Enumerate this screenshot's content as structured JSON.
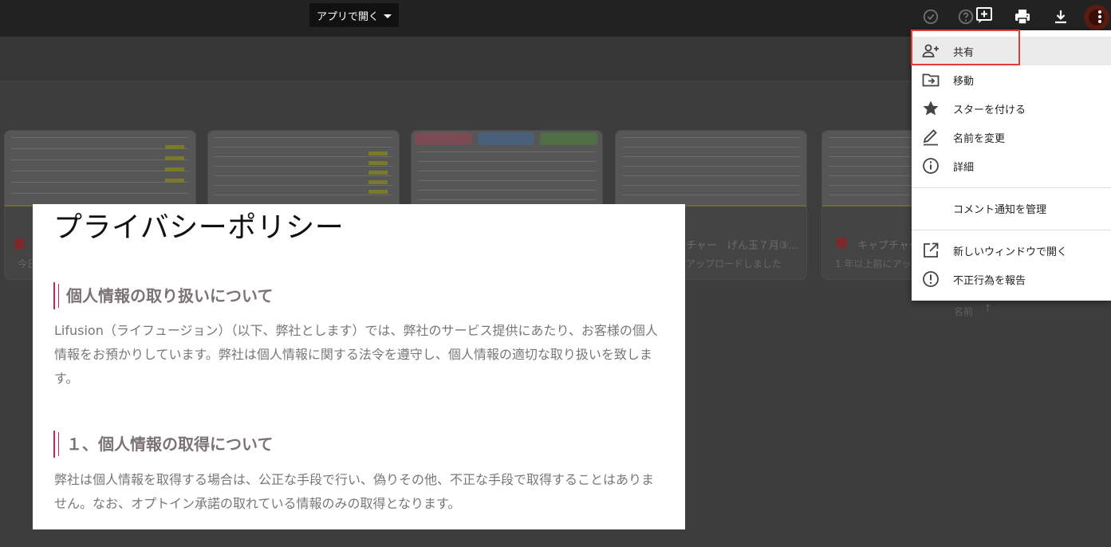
{
  "toolbar": {
    "open_with_label": "アプリで開く"
  },
  "background": {
    "cards": [
      {
        "name": "",
        "subtitle": "今日"
      },
      {
        "name": "",
        "subtitle": ""
      },
      {
        "name": "",
        "subtitle": ""
      },
      {
        "name": "チャー　げん玉７月③...",
        "subtitle": "アップロードしました"
      },
      {
        "name": "キャプチャー",
        "subtitle": "1 年以上前にアップ"
      }
    ],
    "sort_label": "名前",
    "sort_arrow": "↑"
  },
  "document": {
    "title": "プライバシーポリシー",
    "sections": [
      {
        "heading": "個人情報の取り扱いについて",
        "body": "Lifusion（ライフュージョン）（以下、弊社とします）では、弊社のサービス提供にあたり、お客様の個人情報をお預かりしています。弊社は個人情報に関する法令を遵守し、個人情報の適切な取り扱いを致します。"
      },
      {
        "heading": "１、個人情報の取得について",
        "body": "弊社は個人情報を取得する場合は、公正な手段で行い、偽りその他、不正な手段で取得することはありません。なお、オプトイン承諾の取れている情報のみの取得となります。"
      }
    ]
  },
  "menu": {
    "items": [
      {
        "label": "共有",
        "icon": "person-add-icon"
      },
      {
        "label": "移動",
        "icon": "move-to-folder-icon"
      },
      {
        "label": "スターを付ける",
        "icon": "star-icon"
      },
      {
        "label": "名前を変更",
        "icon": "rename-pencil-icon"
      },
      {
        "label": "詳細",
        "icon": "info-icon"
      },
      {
        "label": "コメント通知を管理",
        "icon": ""
      },
      {
        "label": "新しいウィンドウで開く",
        "icon": "open-in-new-icon"
      },
      {
        "label": "不正行為を報告",
        "icon": "report-icon"
      }
    ]
  }
}
